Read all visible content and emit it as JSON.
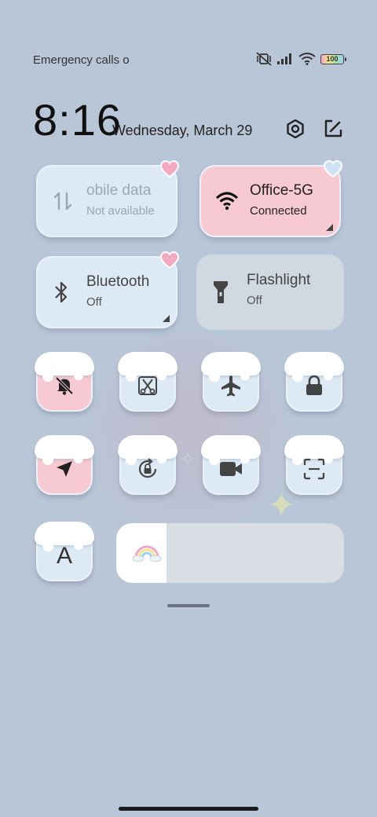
{
  "status_bar": {
    "carrier": "Emergency calls o",
    "battery": "100"
  },
  "header": {
    "time": "8:16",
    "date": "Wednesday, March 29"
  },
  "tiles": {
    "mobile_data": {
      "title": "obile data",
      "subtitle": "Not available"
    },
    "wifi": {
      "title": "Office-5G",
      "subtitle": "Connected"
    },
    "bluetooth": {
      "title": "Bluetooth",
      "subtitle": "Off"
    },
    "flashlight": {
      "title": "Flashlight",
      "subtitle": "Off"
    }
  },
  "toggles": {
    "font_letter": "A"
  },
  "brightness": {
    "level_fraction": 0.22
  },
  "colors": {
    "background": "#b9c6d7",
    "tile_blue": "#dde9f5",
    "tile_pink": "#f7c9d3",
    "heart_pink": "#f3a9bf",
    "heart_blue": "#cfe2f5"
  },
  "icons": {
    "status": [
      "mute-vibrate-icon",
      "signal-icon",
      "wifi-icon",
      "battery-icon"
    ],
    "header": [
      "settings-icon",
      "edit-icon"
    ],
    "toggles_row1": [
      "silent-icon",
      "screenshot-icon",
      "airplane-icon",
      "lock-icon"
    ],
    "toggles_row2": [
      "location-icon",
      "rotation-lock-icon",
      "video-icon",
      "scanner-icon"
    ]
  }
}
